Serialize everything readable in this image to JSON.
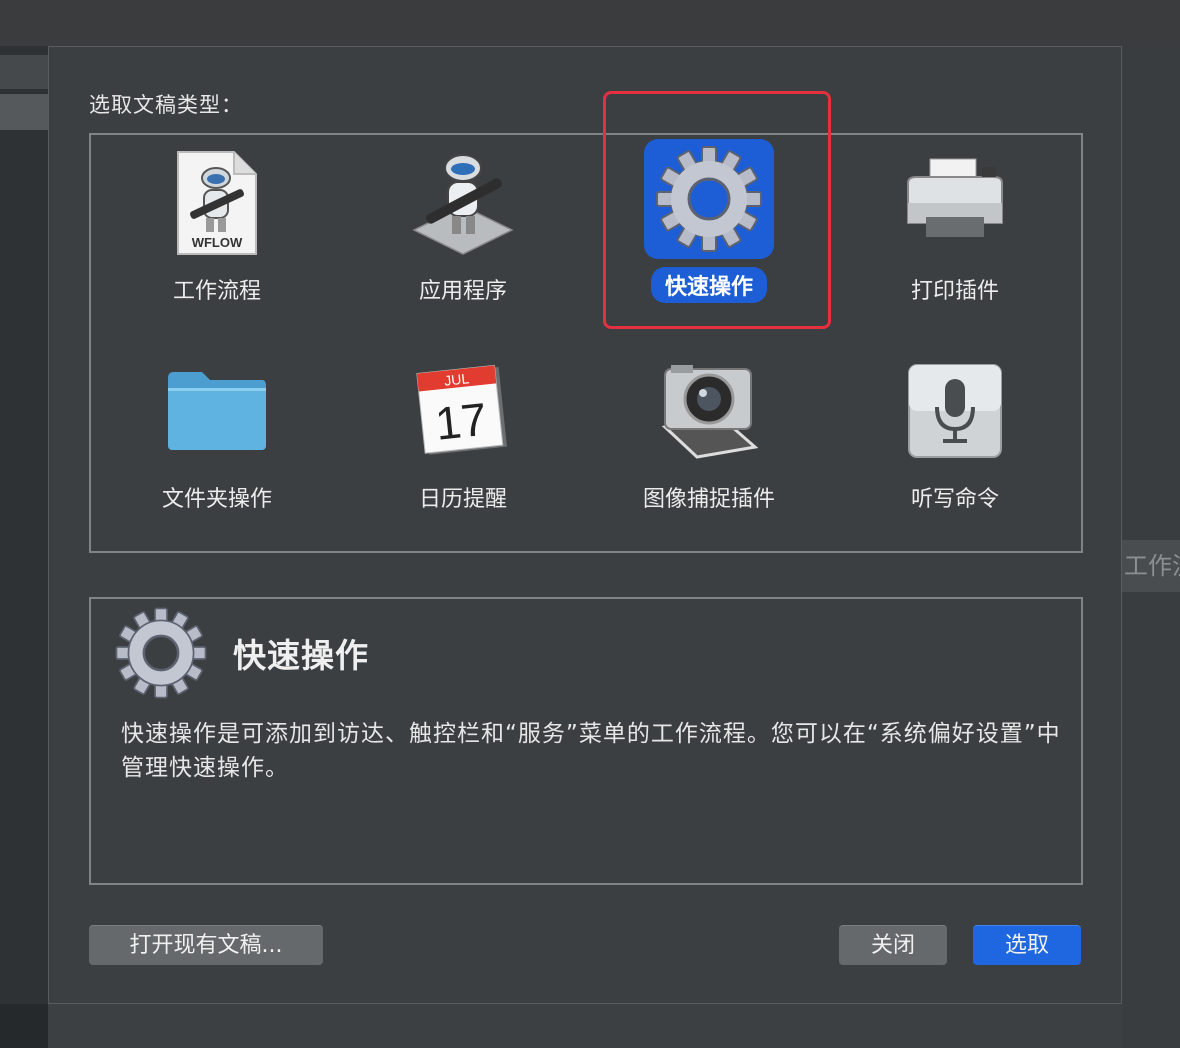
{
  "background": {
    "right_partial_text": "工作流"
  },
  "dialog": {
    "prompt": "选取文稿类型：",
    "types": [
      {
        "label": "工作流程",
        "icon": "workflow-file-icon",
        "file_label": "WFLOW",
        "selected": false
      },
      {
        "label": "应用程序",
        "icon": "automator-robot-icon",
        "selected": false
      },
      {
        "label": "快速操作",
        "icon": "gear-icon",
        "selected": true
      },
      {
        "label": "打印插件",
        "icon": "printer-icon",
        "selected": false
      },
      {
        "label": "文件夹操作",
        "icon": "folder-icon",
        "selected": false
      },
      {
        "label": "日历提醒",
        "icon": "calendar-icon",
        "calendar_month": "JUL",
        "calendar_day": "17",
        "selected": false
      },
      {
        "label": "图像捕捉插件",
        "icon": "camera-icon",
        "selected": false
      },
      {
        "label": "听写命令",
        "icon": "microphone-icon",
        "selected": false
      }
    ],
    "description": {
      "title": "快速操作",
      "text": "快速操作是可添加到访达、触控栏和“服务”菜单的工作流程。您可以在“系统偏好设置”中管理快速操作。"
    },
    "buttons": {
      "open_existing": "打开现有文稿...",
      "close": "关闭",
      "choose": "选取"
    },
    "colors": {
      "selection_blue": "#1d5ed6",
      "highlight_frame_red": "#e5303f"
    }
  }
}
